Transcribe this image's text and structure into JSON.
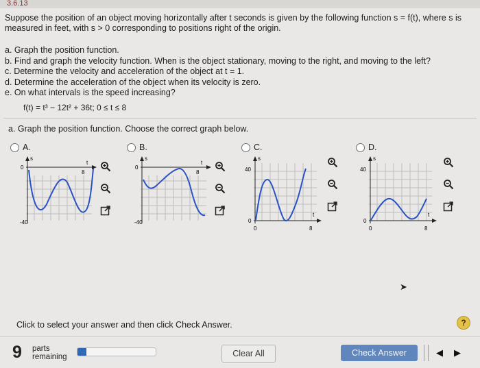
{
  "header": {
    "badge": "3.6.13"
  },
  "problem": {
    "intro": "Suppose the position of an object moving horizontally after t seconds is given by the following function s = f(t), where s is measured in feet, with s > 0 corresponding to positions right of the origin.",
    "parts": [
      "a. Graph the position function.",
      "b. Find and graph the velocity function. When is the object stationary, moving to the right, and moving to the left?",
      "c. Determine the velocity and acceleration of the object at t = 1.",
      "d. Determine the acceleration of the object when its velocity is zero.",
      "e. On what intervals is the speed increasing?"
    ],
    "function_text": "f(t) = t³ − 12t² + 36t; 0 ≤ t ≤ 8"
  },
  "question": "a. Graph the position function. Choose the correct graph below.",
  "options": [
    {
      "label": "A.",
      "y_label": "s",
      "x_label": "t",
      "tick_top": "0",
      "tick_bottom": "-40",
      "tick_x": "8"
    },
    {
      "label": "B.",
      "y_label": "s",
      "x_label": "t",
      "tick_top": "0",
      "tick_bottom": "-40",
      "tick_x": "8"
    },
    {
      "label": "C.",
      "y_label": "s",
      "x_label": "t",
      "tick_top": "40",
      "tick_bottom": "0",
      "tick_x": "8",
      "tick_origin": "0"
    },
    {
      "label": "D.",
      "y_label": "s",
      "x_label": "t",
      "tick_top": "40",
      "tick_bottom": "0",
      "tick_x": "8",
      "tick_origin": "0"
    }
  ],
  "tool_icons": [
    "zoom-in-icon",
    "zoom-out-icon",
    "open-new-window-icon"
  ],
  "instructions": "Click to select your answer and then click Check Answer.",
  "help": "?",
  "footer": {
    "parts_count": "9",
    "parts_label_1": "parts",
    "parts_label_2": "remaining",
    "progress_fraction": 0.11,
    "clear_all": "Clear All",
    "check_answer": "Check Answer",
    "prev": "◀",
    "next": "▶"
  },
  "colors": {
    "curve": "#2a52c4",
    "grid": "#bcbcbc",
    "check_button": "#5f87bd",
    "progress": "#2f68b7",
    "help": "#e4c24a"
  }
}
